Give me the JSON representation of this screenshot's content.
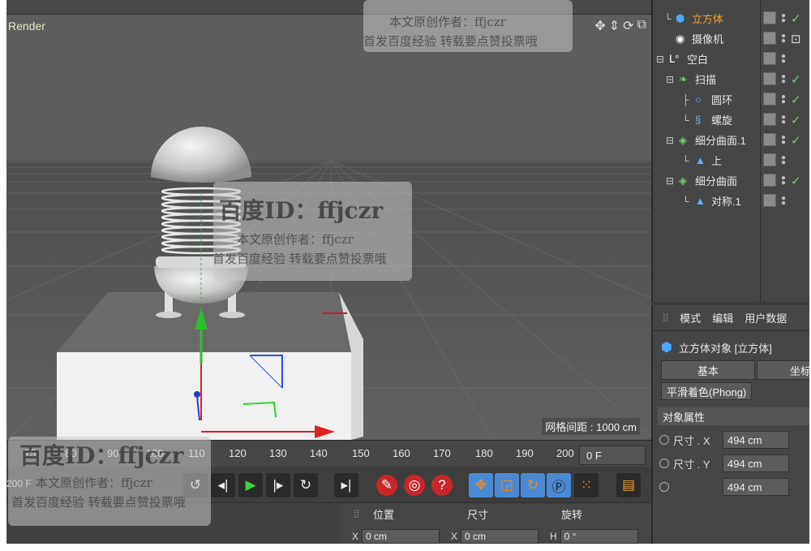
{
  "viewport": {
    "title": "Render",
    "grid_spacing": "网格间距 : 1000 cm",
    "nav_icons": [
      "move-icon",
      "dolly-icon",
      "rotate-view-icon",
      "maximize-icon"
    ]
  },
  "object_manager": {
    "items": [
      {
        "label": "立方体",
        "icon": "cube-icon",
        "selected": true
      },
      {
        "label": "摄像机",
        "icon": "camera-icon"
      },
      {
        "label": "空白",
        "icon": "null-icon"
      },
      {
        "label": "扫描",
        "icon": "sweep-icon"
      },
      {
        "label": "圆环",
        "icon": "circle-icon"
      },
      {
        "label": "螺旋",
        "icon": "helix-icon"
      },
      {
        "label": "细分曲面.1",
        "icon": "subdivision-icon"
      },
      {
        "label": "上",
        "icon": "symmetry-icon"
      },
      {
        "label": "细分曲面",
        "icon": "subdivision-icon"
      },
      {
        "label": "对称.1",
        "icon": "symmetry-icon"
      }
    ]
  },
  "attributes": {
    "menu": [
      "模式",
      "编辑",
      "用户数据"
    ],
    "object_title": "立方体对象 [立方体]",
    "tabs": [
      "基本",
      "坐标"
    ],
    "phong_button": "平滑着色(Phong)",
    "section": "对象属性",
    "size_x_label": "尺寸 . X",
    "size_x_value": "494 cm",
    "size_y_label": "尺寸 . Y",
    "size_y_value": "494 cm",
    "size_z_value": "494 cm"
  },
  "timeline": {
    "ticks": [
      "75",
      "80",
      "90",
      "100",
      "110",
      "120",
      "130",
      "140",
      "150",
      "160",
      "170",
      "180",
      "190",
      "200"
    ],
    "current_frame": "0 F",
    "end_frame": "200 F"
  },
  "coordinates": {
    "headers": [
      "位置",
      "尺寸",
      "旋转"
    ],
    "x_label": "X",
    "x_value": "0 cm",
    "sx_label": "X",
    "sx_value": "0 cm",
    "h_label": "H",
    "h_value": "0 °"
  },
  "watermarks": {
    "id_text": "百度ID：ffjczr",
    "line1": "本文原创作者：ffjczr",
    "line2": "首发百度经验  转载要点赞投票哦"
  },
  "colors": {
    "viewport_bg": "#5a5a5a",
    "panel_bg": "#464646",
    "selected_text": "#f0a030",
    "check_green": "#6fd06f",
    "record_red": "#c8272a",
    "tool_blue": "#4a8ad4"
  }
}
